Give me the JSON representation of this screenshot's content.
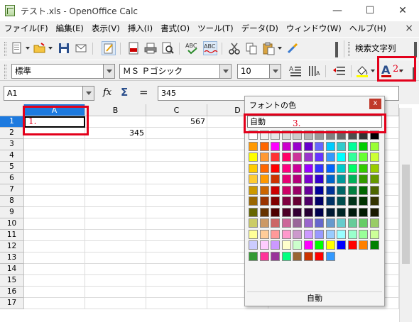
{
  "window": {
    "title": "テスト.xls - OpenOffice Calc",
    "min_glyph": "—",
    "max_glyph": "☐",
    "close_glyph": "✕"
  },
  "menu": {
    "items": [
      "ファイル(F)",
      "編集(E)",
      "表示(V)",
      "挿入(I)",
      "書式(O)",
      "ツール(T)",
      "データ(D)",
      "ウィンドウ(W)",
      "ヘルプ(H)"
    ],
    "close_glyph": "×"
  },
  "toolbar": {
    "search_label": "検索文字列"
  },
  "format_toolbar": {
    "style_value": "標準",
    "font_value": "ＭＳ Ｐゴシック",
    "size_value": "10",
    "font_color_glyph": "A"
  },
  "formula_bar": {
    "name_box": "A1",
    "content": "345",
    "fx_glyph": "fx",
    "sum_glyph": "Σ",
    "equals_glyph": "="
  },
  "sheet": {
    "columns": [
      "A",
      "B",
      "C",
      "D"
    ],
    "rows": [
      "1",
      "2",
      "3",
      "4",
      "5",
      "6",
      "7",
      "8",
      "9",
      "10",
      "11",
      "12",
      "13",
      "14",
      "15",
      "16",
      "17"
    ],
    "c1": "567",
    "b2": "345"
  },
  "popup": {
    "title": "フォントの色",
    "close_glyph": "x",
    "auto_top": "自動",
    "auto_bottom": "自動",
    "swatch_colors": [
      "#ffffff",
      "#f2f2f2",
      "#e6e6e6",
      "#d9d9d9",
      "#cccccc",
      "#b3b3b3",
      "#999999",
      "#808080",
      "#666666",
      "#4d4d4d",
      "#333333",
      "#000000",
      "#ff9900",
      "#ff6600",
      "#ff00ff",
      "#cc00cc",
      "#9900cc",
      "#6600cc",
      "#6666ff",
      "#00ccff",
      "#33cccc",
      "#00ff99",
      "#00cc00",
      "#99ff33",
      "#ffff00",
      "#ff9933",
      "#ff3333",
      "#ff0066",
      "#cc3399",
      "#9933cc",
      "#6633ff",
      "#3399ff",
      "#00ffff",
      "#33ff99",
      "#66ff33",
      "#ccff33",
      "#ffcc00",
      "#ff6600",
      "#ff0000",
      "#ff0080",
      "#cc0099",
      "#9900ff",
      "#3333ff",
      "#0066ff",
      "#00cccc",
      "#00ff66",
      "#33cc00",
      "#99cc00",
      "#ffcc33",
      "#ff9900",
      "#cc3300",
      "#e60073",
      "#b3007a",
      "#7a00cc",
      "#3300cc",
      "#0066cc",
      "#009999",
      "#00b359",
      "#339900",
      "#669900",
      "#cc9900",
      "#cc6600",
      "#cc0000",
      "#cc0066",
      "#990066",
      "#660099",
      "#000099",
      "#003399",
      "#006666",
      "#008040",
      "#006600",
      "#4d6600",
      "#996600",
      "#993300",
      "#800000",
      "#800040",
      "#660033",
      "#4d0066",
      "#000066",
      "#003366",
      "#004d4d",
      "#00331a",
      "#003300",
      "#333300",
      "#666600",
      "#663300",
      "#4d0000",
      "#4d0026",
      "#330033",
      "#260033",
      "#00004d",
      "#001a33",
      "#002626",
      "#001a0d",
      "#001a00",
      "#1a1a00",
      "#cccc66",
      "#cc9966",
      "#cc6666",
      "#cc6699",
      "#996699",
      "#9966cc",
      "#6666cc",
      "#6699cc",
      "#66cccc",
      "#66cc99",
      "#66cc66",
      "#99cc66",
      "#ffff99",
      "#ffcc99",
      "#ff9999",
      "#ff99cc",
      "#cc99cc",
      "#cc99ff",
      "#9999ff",
      "#99ccff",
      "#99ffff",
      "#99ffcc",
      "#99ff99",
      "#ccff99",
      "#ccccff",
      "#ffccff",
      "#cc99ff",
      "#ffffcc",
      "#ccffcc",
      "#ff00ff",
      "#00ff00",
      "#ffff00",
      "#0000ff",
      "#ff0000",
      "#ff8000",
      "#008000",
      "#339933",
      "#ff3399",
      "#993399",
      "#00ff80",
      "#996633",
      "#cc3300",
      "#ff0000",
      "#3399ff"
    ]
  },
  "annotations": {
    "step1": "1.",
    "step2": "2.",
    "step3": "3."
  },
  "colors": {
    "annotation_red": "#e3001b",
    "selection_blue": "#1d7adf"
  }
}
